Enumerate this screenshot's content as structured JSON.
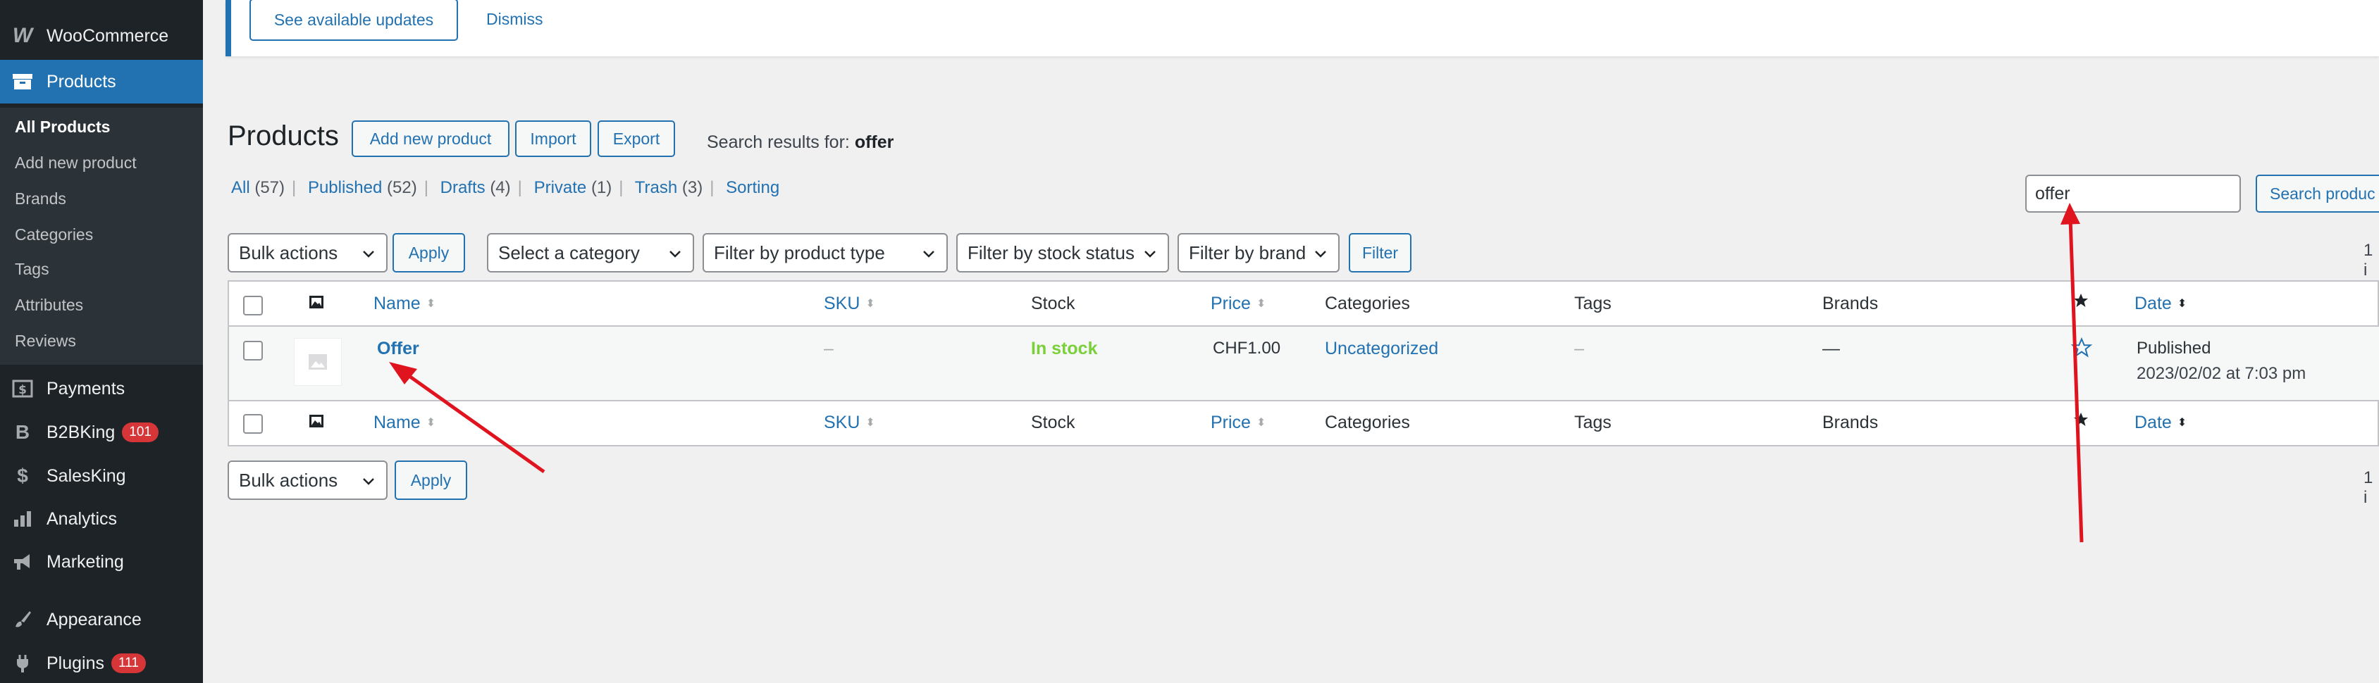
{
  "sidebar": {
    "woocommerce": "WooCommerce",
    "products": "Products",
    "submenu": [
      "All Products",
      "Add new product",
      "Brands",
      "Categories",
      "Tags",
      "Attributes",
      "Reviews"
    ],
    "payments": "Payments",
    "b2bking": "B2BKing",
    "b2bking_badge": "101",
    "salesking": "SalesKing",
    "analytics": "Analytics",
    "marketing": "Marketing",
    "appearance": "Appearance",
    "plugins": "Plugins",
    "plugins_badge": "111"
  },
  "notice": {
    "updates_button": "See available updates",
    "dismiss": "Dismiss"
  },
  "header": {
    "title": "Products",
    "add_new": "Add new product",
    "import": "Import",
    "export": "Export",
    "search_results_label": "Search results for:",
    "search_term": "offer"
  },
  "status_links": [
    {
      "label": "All",
      "count": "(57)"
    },
    {
      "label": "Published",
      "count": "(52)"
    },
    {
      "label": "Drafts",
      "count": "(4)"
    },
    {
      "label": "Private",
      "count": "(1)"
    },
    {
      "label": "Trash",
      "count": "(3)"
    },
    {
      "label": "Sorting",
      "count": ""
    }
  ],
  "search": {
    "value": "offer",
    "button": "Search produc"
  },
  "filters": {
    "bulk_actions": "Bulk actions",
    "apply": "Apply",
    "category": "Select a category",
    "product_type": "Filter by product type",
    "stock_status": "Filter by stock status",
    "brand": "Filter by brand",
    "filter": "Filter",
    "page_count": "1 i"
  },
  "table": {
    "columns": {
      "name": "Name",
      "sku": "SKU",
      "stock": "Stock",
      "price": "Price",
      "categories": "Categories",
      "tags": "Tags",
      "brands": "Brands",
      "date": "Date"
    },
    "rows": [
      {
        "name": "Offer",
        "sku": "–",
        "stock": "In stock",
        "price": "CHF1.00",
        "categories": "Uncategorized",
        "tags": "–",
        "brands": "—",
        "date_status": "Published",
        "date": "2023/02/02 at 7:03 pm"
      }
    ]
  },
  "colors": {
    "accent": "#2271b1",
    "sidebar_bg": "#1d2327",
    "in_stock": "#7ad03a",
    "annotation": "#e0141e"
  }
}
